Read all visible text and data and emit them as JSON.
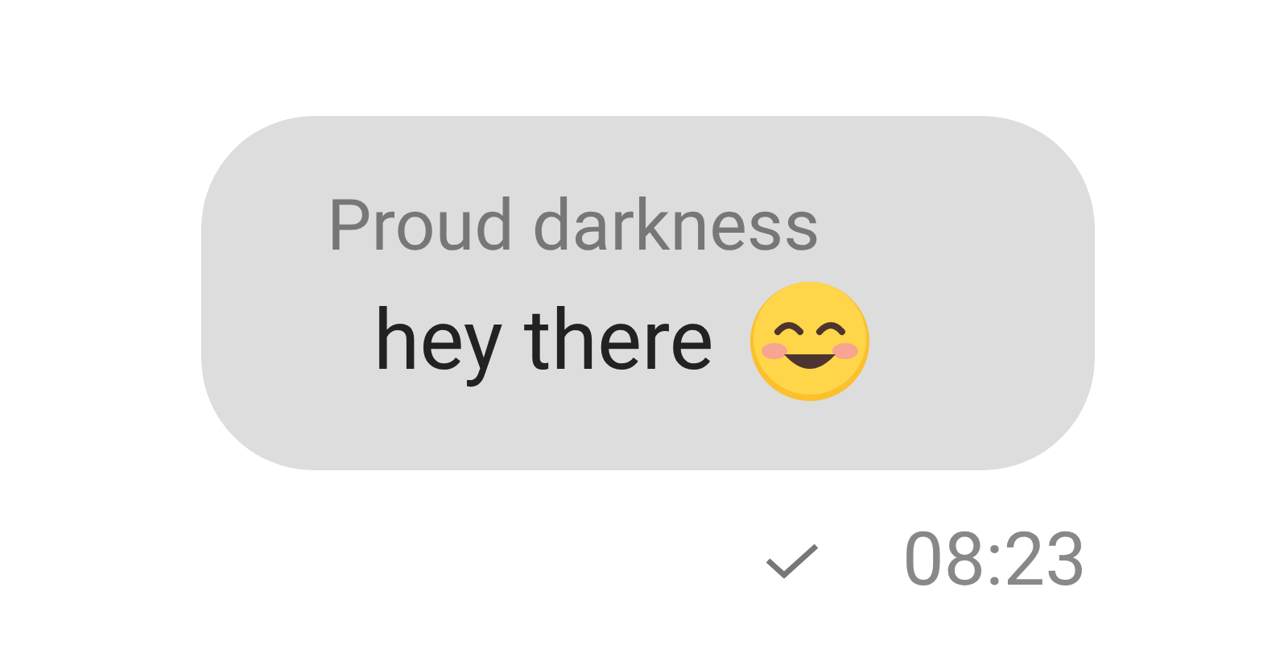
{
  "message": {
    "sender": "Proud darkness",
    "text": "hey there",
    "time": "08:23",
    "delivered": true
  }
}
